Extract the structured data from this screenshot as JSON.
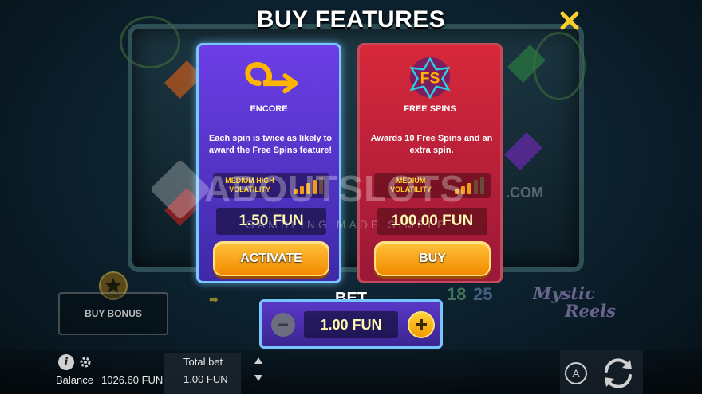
{
  "header": {
    "title": "BUY FEATURES"
  },
  "features": [
    {
      "name": "ENCORE",
      "description": "Each spin is twice as likely to award the Free Spins feature!",
      "volatility": "MEDIUM HIGH VOLATILITY",
      "volatility_level": 4,
      "volatility_max": 5,
      "price": "1.50 FUN",
      "action_label": "ACTIVATE",
      "icon": "loop-arrow-icon"
    },
    {
      "name": "FREE SPINS",
      "description": "Awards 10 Free Spins and an extra spin.",
      "volatility": "MEDIUM VOLATILITY",
      "volatility_level": 3,
      "volatility_max": 5,
      "price": "100.00 FUN",
      "action_label": "BUY",
      "icon": "fs-star-icon"
    }
  ],
  "watermark": {
    "brand": "ABOUTSLOTS",
    "tld": ".COM",
    "tagline": "GAMBLING MADE SIMPLE"
  },
  "buy_bonus": {
    "label": "BUY BONUS"
  },
  "bet": {
    "label": "BET",
    "value": "1.00 FUN"
  },
  "decor": {
    "fs_a": "18",
    "fs_b": "25",
    "fs_sub": "FS",
    "logo_line1": "Mystic",
    "logo_line2": "Reels"
  },
  "footer": {
    "balance_label": "Balance",
    "balance_value": "1026.60 FUN",
    "total_bet_label": "Total bet",
    "total_bet_value": "1.00 FUN",
    "autoplay_label": "A"
  },
  "colors": {
    "accent": "#ffc23a",
    "encore_bg": "#5534d0",
    "freespins_bg": "#c8213a",
    "frame_glow": "#78c4ff"
  }
}
